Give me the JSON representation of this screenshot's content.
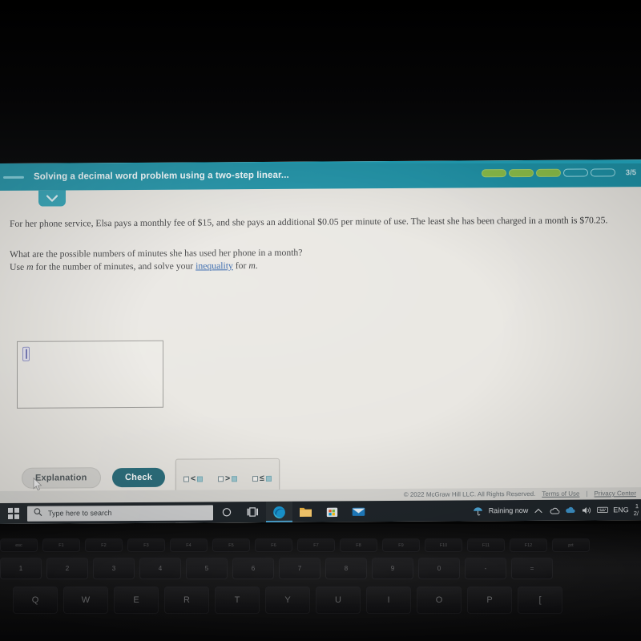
{
  "header": {
    "title": "Solving a decimal word problem using a two-step linear...",
    "menu_icon": "menu-dash-icon",
    "progress_label": "3/5",
    "progress_total": 5,
    "progress_done": 3,
    "collapse_icon": "chevron-down-icon",
    "accent_color": "#1f93a8",
    "progress_fill_color": "#8cbf4a"
  },
  "problem": {
    "paragraph": "For her phone service, Elsa pays a monthly fee of $15, and she pays an additional $0.05 per minute of use. The least she has been charged in a month is $70.25.",
    "question_line1": "What are the possible numbers of minutes she has used her phone in a month?",
    "question_line2_pre": "Use ",
    "question_var1": "m",
    "question_line2_mid": " for the number of minutes, and solve your ",
    "question_link": "inequality",
    "question_line2_post": " for ",
    "question_var2": "m",
    "question_line2_end": "."
  },
  "answer_input": {
    "value": "",
    "placeholder": "",
    "caret_icon": "text-caret-icon"
  },
  "palette": {
    "keys": [
      {
        "name": "less-than",
        "op": "<"
      },
      {
        "name": "greater-than",
        "op": ">"
      },
      {
        "name": "less-than-or-equal",
        "op": "≤"
      },
      {
        "name": "greater-than-or-equal",
        "op": "≥"
      }
    ],
    "tools": [
      {
        "name": "clear-button",
        "glyph": "×"
      },
      {
        "name": "undo-button",
        "glyph": "↺"
      },
      {
        "name": "help-button",
        "glyph": "?"
      }
    ]
  },
  "actions": {
    "explanation_label": "Explanation",
    "check_label": "Check",
    "check_color": "#2b6e7c"
  },
  "footer": {
    "copyright": "© 2022 McGraw Hill LLC. All Rights Reserved.",
    "terms_label": "Terms of Use",
    "separator": "|",
    "privacy_label": "Privacy Center"
  },
  "taskbar": {
    "start_icon": "windows-logo-icon",
    "search_placeholder": "Type here to search",
    "search_icon": "search-icon",
    "cortana_icon": "cortana-circle-icon",
    "taskview_icon": "task-view-icon",
    "apps": [
      {
        "name": "edge-browser-icon"
      },
      {
        "name": "file-explorer-icon"
      },
      {
        "name": "microsoft-store-icon"
      },
      {
        "name": "mail-icon"
      }
    ],
    "weather_text": "Raining now",
    "weather_icon": "umbrella-icon",
    "tray": [
      {
        "name": "show-hidden-icons-chevron"
      },
      {
        "name": "onedrive-icon"
      },
      {
        "name": "cloud-icon"
      },
      {
        "name": "volume-icon"
      },
      {
        "name": "touch-keyboard-icon"
      }
    ],
    "language": "ENG",
    "clock_line1": "1",
    "clock_line2": "2/"
  },
  "keyboard": {
    "fn_row": [
      "esc",
      "F1",
      "F2",
      "F3",
      "F4",
      "F5",
      "F6",
      "F7",
      "F8",
      "F9",
      "F10",
      "F11",
      "F12",
      "prt"
    ],
    "number_row": [
      "1",
      "2",
      "3",
      "4",
      "5",
      "6",
      "7",
      "8",
      "9",
      "0",
      "-",
      "="
    ],
    "letter_row": [
      "Q",
      "W",
      "E",
      "R",
      "T",
      "Y",
      "U",
      "I",
      "O",
      "P",
      "["
    ]
  }
}
